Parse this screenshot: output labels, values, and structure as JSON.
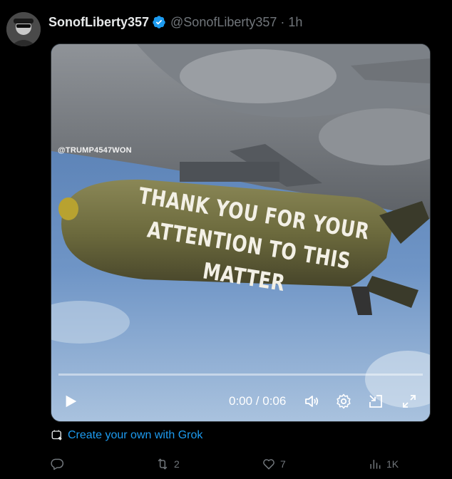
{
  "tweet": {
    "display_name": "SonofLiberty357",
    "handle": "@SonofLiberty357",
    "separator": "·",
    "time": "1h"
  },
  "media": {
    "watermark": "@TRUMP4547WON",
    "bomb_text_line1": "THANK YOU FOR YOUR",
    "bomb_text_line2": "ATTENTION TO THIS MATTER",
    "timecode": "0:00 / 0:06",
    "progress": 0
  },
  "grok_link": "Create your own with Grok",
  "actions": {
    "replies": "",
    "retweets": "2",
    "likes": "7",
    "views": "1K"
  },
  "colors": {
    "background": "#000000",
    "accent": "#1d9bf0",
    "muted": "#71767b",
    "text": "#e7e9ea"
  }
}
